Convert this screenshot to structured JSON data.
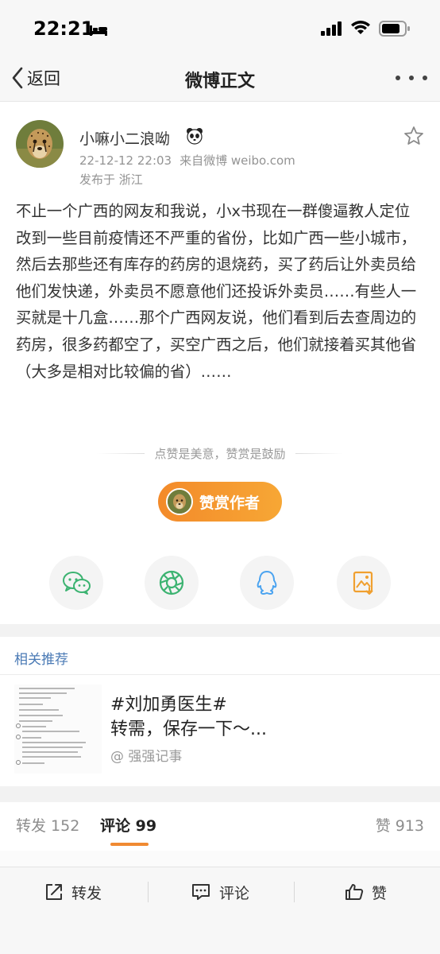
{
  "status_bar": {
    "time": "22:21"
  },
  "nav": {
    "back_label": "返回",
    "title": "微博正文"
  },
  "post": {
    "author": "小嘛小二浪呦",
    "timestamp": "22-12-12 22:03",
    "source": "来自微博 weibo.com",
    "location": "发布于 浙江",
    "text": "不止一个广西的网友和我说，小x书现在一群傻逼教人定位改到一些目前疫情还不严重的省份，比如广西一些小城市，然后去那些还有库存的药房的退烧药，买了药后让外卖员给他们发快递，外卖员不愿意他们还投诉外卖员……有些人一买就是十几盒……那个广西网友说，他们看到后去查周边的药房，很多药都空了，买空广西之后，他们就接着买其他省（大多是相对比较偏的省）……"
  },
  "reward": {
    "slogan": "点赞是美意，赞赏是鼓励",
    "button_label": "赞赏作者"
  },
  "share": {
    "icons": [
      "wechat-icon",
      "moments-icon",
      "qq-icon",
      "save-image-icon"
    ]
  },
  "related": {
    "title": "相关推荐",
    "card": {
      "headline": "#刘加勇医生#\n转需，保存一下～...",
      "source": "@ 强强记事"
    }
  },
  "tabs": {
    "repost": "转发 152",
    "comment": "评论 99",
    "like": "赞 913"
  },
  "bottom_bar": {
    "repost": "转发",
    "comment": "评论",
    "like": "赞"
  },
  "colors": {
    "accent": "#f08a32",
    "link": "#4a7ab5",
    "wechat": "#3cb371",
    "moments": "#3cb371",
    "qq": "#4aa3f0",
    "save": "#f0a030"
  }
}
